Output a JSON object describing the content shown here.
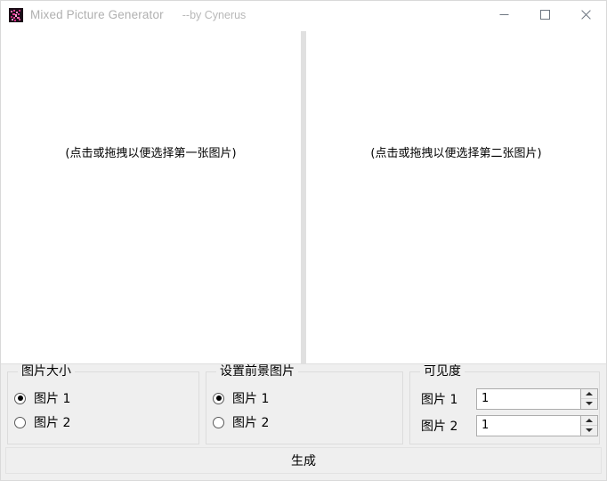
{
  "window": {
    "title": "Mixed Picture Generator",
    "subtitle": "--by Cynerus",
    "icon": "app-icon",
    "controls": {
      "minimize": "minimize-icon",
      "maximize": "maximize-icon",
      "close": "close-icon"
    }
  },
  "panes": [
    {
      "id": "first-image",
      "hint": "(点击或拖拽以便选择第一张图片)"
    },
    {
      "id": "second-image",
      "hint": "(点击或拖拽以便选择第二张图片)"
    }
  ],
  "groups": {
    "size": {
      "title": "图片大小",
      "options": [
        {
          "label": "图片 1",
          "checked": true
        },
        {
          "label": "图片 2",
          "checked": false
        }
      ]
    },
    "foreground": {
      "title": "设置前景图片",
      "options": [
        {
          "label": "图片 1",
          "checked": true
        },
        {
          "label": "图片 2",
          "checked": false
        }
      ]
    },
    "visibility": {
      "title": "可见度",
      "rows": [
        {
          "label": "图片 1",
          "value": "1"
        },
        {
          "label": "图片 2",
          "value": "1"
        }
      ]
    }
  },
  "actions": {
    "generate_label": "生成"
  },
  "colors": {
    "panel": "#efefef",
    "canvas": "#ffffff",
    "divider": "#e0e0e0",
    "groupbox_border": "#dcdcdc",
    "title_text": "#b0b0b0",
    "accent_icon": "#e8409a"
  }
}
